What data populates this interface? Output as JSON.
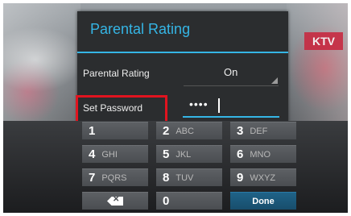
{
  "dialog": {
    "title": "Parental Rating",
    "rating_label": "Parental Rating",
    "rating_value": "On",
    "password_label": "Set Password",
    "password_masked": "••••"
  },
  "background": {
    "sign_text": "KTV"
  },
  "keypad": {
    "rows": [
      [
        {
          "num": "1",
          "letters": ""
        },
        {
          "num": "2",
          "letters": "ABC"
        },
        {
          "num": "3",
          "letters": "DEF"
        }
      ],
      [
        {
          "num": "4",
          "letters": "GHI"
        },
        {
          "num": "5",
          "letters": "JKL"
        },
        {
          "num": "6",
          "letters": "MNO"
        }
      ],
      [
        {
          "num": "7",
          "letters": "PQRS"
        },
        {
          "num": "8",
          "letters": "TUV"
        },
        {
          "num": "9",
          "letters": "WXYZ"
        }
      ]
    ],
    "zero": "0",
    "done_label": "Done",
    "backspace_icon": "backspace-icon"
  },
  "colors": {
    "accent": "#35b5e5",
    "highlight": "#e0141f",
    "done_key": "#1f6388"
  }
}
